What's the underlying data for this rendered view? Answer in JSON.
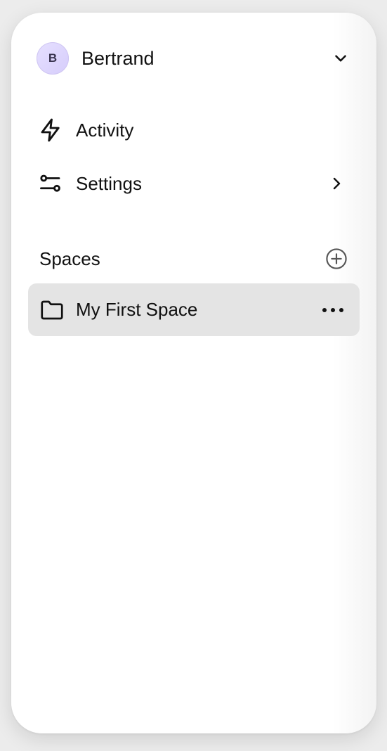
{
  "account": {
    "avatar_initial": "B",
    "name": "Bertrand",
    "menu_icon": "chevron-down-icon"
  },
  "nav": {
    "items": [
      {
        "label": "Activity",
        "icon": "bolt-icon"
      },
      {
        "label": "Settings",
        "icon": "sliders-icon",
        "trailing_icon": "chevron-right-icon"
      }
    ]
  },
  "spaces": {
    "title": "Spaces",
    "add_icon": "plus-circle-icon",
    "items": [
      {
        "label": "My First Space",
        "icon": "folder-icon",
        "menu_icon": "more-horizontal-icon"
      }
    ]
  },
  "colors": {
    "selected_bg": "#e4e4e4",
    "avatar_bg": "#ded6fb",
    "text": "#111111"
  }
}
